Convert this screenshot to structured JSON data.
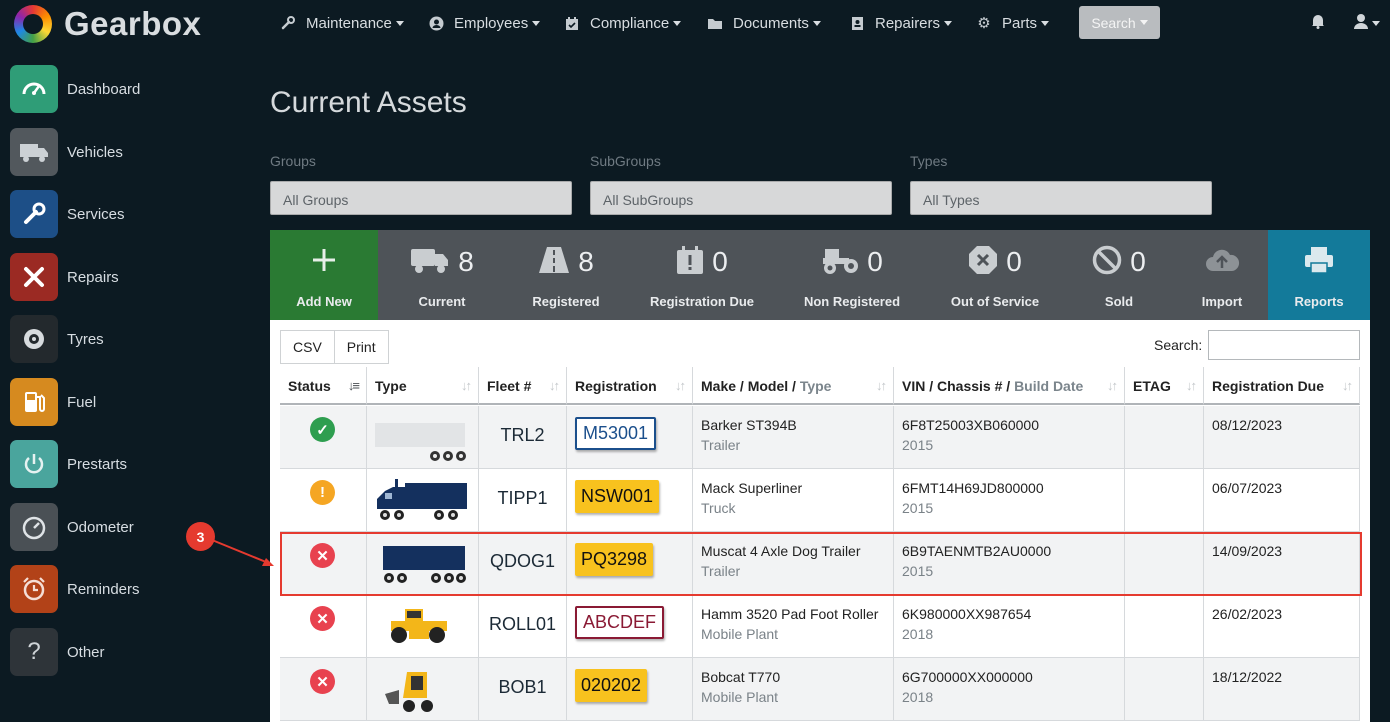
{
  "app": {
    "name": "Gearbox"
  },
  "sidebar": {
    "items": [
      {
        "label": "Dashboard",
        "icon": "dashboard-icon",
        "color": "#2f9d77"
      },
      {
        "label": "Vehicles",
        "icon": "truck-icon",
        "color": "#52585d"
      },
      {
        "label": "Services",
        "icon": "wrench-icon",
        "color": "#1d4f87"
      },
      {
        "label": "Repairs",
        "icon": "tools-icon",
        "color": "#9b2a23"
      },
      {
        "label": "Tyres",
        "icon": "tyre-icon",
        "color": "#23292d"
      },
      {
        "label": "Fuel",
        "icon": "fuel-icon",
        "color": "#d68a1f"
      },
      {
        "label": "Prestarts",
        "icon": "power-icon",
        "color": "#4aa59d"
      },
      {
        "label": "Odometer",
        "icon": "speedometer-icon",
        "color": "#4a5055"
      },
      {
        "label": "Reminders",
        "icon": "alarm-clock-icon",
        "color": "#b24218"
      },
      {
        "label": "Other",
        "icon": "question-icon",
        "color": "#2e3439"
      }
    ]
  },
  "nav": {
    "items": [
      {
        "label": "Maintenance",
        "icon": "wrench-icon"
      },
      {
        "label": "Employees",
        "icon": "person-icon"
      },
      {
        "label": "Compliance",
        "icon": "calendar-check-icon"
      },
      {
        "label": "Documents",
        "icon": "folder-icon"
      },
      {
        "label": "Repairers",
        "icon": "address-book-icon"
      },
      {
        "label": "Parts",
        "icon": "gear-icon"
      }
    ],
    "search_label": "Search"
  },
  "page": {
    "title": "Current Assets"
  },
  "filters": {
    "groups": {
      "label": "Groups",
      "value": "All Groups"
    },
    "subgroups": {
      "label": "SubGroups",
      "value": "All SubGroups"
    },
    "types": {
      "label": "Types",
      "value": "All Types"
    }
  },
  "stats": {
    "add_new": "Add New",
    "current": {
      "count": "8",
      "label": "Current"
    },
    "registered": {
      "count": "8",
      "label": "Registered"
    },
    "registration_due": {
      "count": "0",
      "label": "Registration Due"
    },
    "non_registered": {
      "count": "0",
      "label": "Non Registered"
    },
    "out_of_service": {
      "count": "0",
      "label": "Out of Service"
    },
    "sold": {
      "count": "0",
      "label": "Sold"
    },
    "import": "Import",
    "reports": "Reports"
  },
  "toolbar": {
    "csv": "CSV",
    "print": "Print",
    "search_label": "Search:"
  },
  "table": {
    "headers": {
      "status": "Status",
      "type": "Type",
      "fleet": "Fleet #",
      "registration": "Registration",
      "make_model": "Make / Model /",
      "make_type": "Type",
      "vin": "VIN / Chassis # /",
      "vin_build": "Build Date",
      "etag": "ETAG",
      "reg_due": "Registration Due"
    },
    "rows": [
      {
        "status": "ok",
        "fleet": "TRL2",
        "rego": "M53001",
        "rego_style": "blue",
        "make": "Barker ST394B",
        "type": "Trailer",
        "vin": "6F8T25003XB060000",
        "year": "2015",
        "etag": "",
        "due": "08/12/2023"
      },
      {
        "status": "warn",
        "fleet": "TIPP1",
        "rego": "NSW001",
        "rego_style": "yellow",
        "make": "Mack Superliner",
        "type": "Truck",
        "vin": "6FMT14H69JD800000",
        "year": "2015",
        "etag": "",
        "due": "06/07/2023"
      },
      {
        "status": "bad",
        "fleet": "QDOG1",
        "rego": "PQ3298",
        "rego_style": "yellow",
        "make": "Muscat 4 Axle Dog Trailer",
        "type": "Trailer",
        "vin": "6B9TAENMTB2AU0000",
        "year": "2015",
        "etag": "",
        "due": "14/09/2023"
      },
      {
        "status": "bad",
        "fleet": "ROLL01",
        "rego": "ABCDEF",
        "rego_style": "red",
        "make": "Hamm 3520 Pad Foot Roller",
        "type": "Mobile Plant",
        "vin": "6K980000XX987654",
        "year": "2018",
        "etag": "",
        "due": "26/02/2023"
      },
      {
        "status": "bad",
        "fleet": "BOB1",
        "rego": "020202",
        "rego_style": "yellow",
        "make": "Bobcat T770",
        "type": "Mobile Plant",
        "vin": "6G700000XX000000",
        "year": "2018",
        "etag": "",
        "due": "18/12/2022"
      }
    ]
  },
  "annotation": {
    "badge": "3"
  },
  "colors": {
    "ok": "#2e9e4f",
    "warn": "#f5a623",
    "bad": "#e8424f",
    "accent_red": "#e53a2f"
  }
}
